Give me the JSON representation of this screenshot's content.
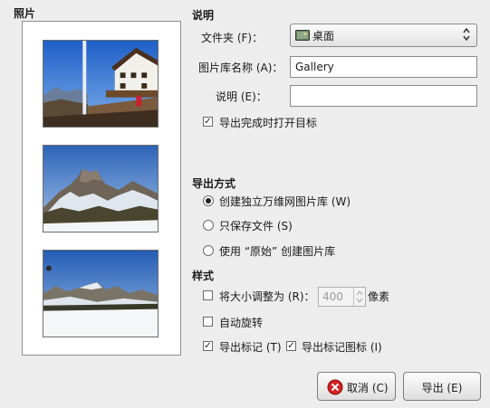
{
  "preview": {
    "title": "照片",
    "images": [
      {
        "name": "photo-house-mountain"
      },
      {
        "name": "photo-snowy-peak"
      },
      {
        "name": "photo-snowy-field"
      }
    ]
  },
  "description_section": {
    "title": "说明",
    "folder_label": "文件夹 (F)：",
    "folder_value": "桌面",
    "folder_icon": "folder-icon",
    "gallery_name_label": "图片库名称 (A)：",
    "gallery_name_value": "Gallery",
    "description_label": "说明 (E)：",
    "description_value": "",
    "open_after_label": "导出完成时打开目标",
    "open_after_checked": true
  },
  "export_method": {
    "title": "导出方式",
    "options": [
      {
        "label": "创建独立万维网图片库 (W)",
        "selected": true
      },
      {
        "label": "只保存文件 (S)",
        "selected": false
      },
      {
        "label": "使用 “原始” 创建图片库",
        "selected": false
      }
    ]
  },
  "style": {
    "title": "样式",
    "resize_label": "将大小调整为 (R)：",
    "resize_checked": false,
    "resize_value": "400",
    "resize_unit": "像素",
    "autorotate_label": "自动旋转",
    "autorotate_checked": false,
    "export_tags_label": "导出标记 (T)",
    "export_tags_checked": true,
    "export_tag_icons_label": "导出标记图标 (I)",
    "export_tag_icons_checked": true
  },
  "buttons": {
    "cancel_label": "取消 (C)",
    "export_label": "导出 (E)"
  },
  "colors": {
    "cancel_icon": "#d42020"
  }
}
